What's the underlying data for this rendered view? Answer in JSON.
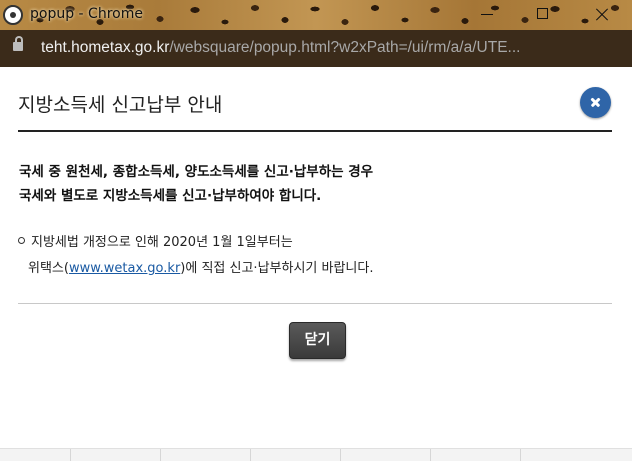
{
  "window": {
    "title": "popup - Chrome",
    "controls": [
      "minimize-icon",
      "maximize-icon",
      "close-icon"
    ]
  },
  "address_bar": {
    "domain": "teht.hometax.go.kr",
    "path": "/websquare/popup.html?w2xPath=/ui/rm/a/a/UTE..."
  },
  "popup": {
    "title": "지방소득세 신고납부 안내",
    "notice_line1": "국세 중 원천세, 종합소득세, 양도소득세를 신고·납부하는 경우",
    "notice_line2": "국세와 별도로 지방소득세를 신고·납부하여야 합니다.",
    "bullet_line1": "지방세법 개정으로 인해 2020년 1월 1일부터는",
    "bullet_line2_prefix": "위택스(",
    "bullet_link": "www.wetax.go.kr",
    "bullet_line2_suffix": ")에 직접 신고·납부하시기 바랍니다.",
    "close_button_label": "닫기"
  },
  "colors": {
    "accent_blue": "#2f65a8",
    "link_blue": "#1a5aa3",
    "button_dark": "#444444",
    "urlbar_bg": "#3b2b1a"
  }
}
